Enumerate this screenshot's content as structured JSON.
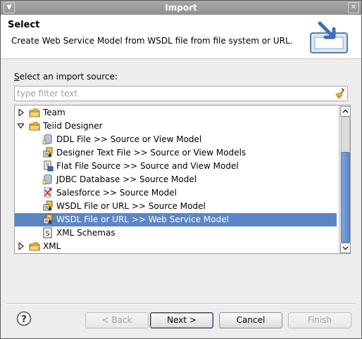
{
  "window": {
    "title": "Import"
  },
  "header": {
    "title": "Select",
    "description": "Create Web Service Model from WSDL file from file system or URL."
  },
  "source_label": {
    "mnemonic": "S",
    "rest": "elect an import source:"
  },
  "filter": {
    "placeholder": "type filter text",
    "value": ""
  },
  "tree": {
    "items": [
      {
        "label": "Team",
        "level": 0,
        "kind": "folder",
        "expander": "collapsed",
        "selected": false
      },
      {
        "label": "Teiid Designer",
        "level": 0,
        "kind": "folder",
        "expander": "expanded",
        "selected": false
      },
      {
        "label": "DDL File >> Source or View Model",
        "level": 1,
        "kind": "db",
        "selected": false
      },
      {
        "label": "Designer Text File >> Source or View Models",
        "level": 1,
        "kind": "package",
        "selected": false
      },
      {
        "label": "Flat File Source >> Source and View Model",
        "level": 1,
        "kind": "flatfile",
        "selected": false
      },
      {
        "label": "JDBC Database >> Source Model",
        "level": 1,
        "kind": "db",
        "selected": false
      },
      {
        "label": "Salesforce >> Source Model",
        "level": 1,
        "kind": "salesforce",
        "selected": false
      },
      {
        "label": "WSDL File or URL >> Source Model",
        "level": 1,
        "kind": "package",
        "selected": false
      },
      {
        "label": "WSDL File or URL >> Web Service Model",
        "level": 1,
        "kind": "package",
        "selected": true
      },
      {
        "label": "XML Schemas",
        "level": 1,
        "kind": "schema",
        "selected": false
      },
      {
        "label": "XML",
        "level": 0,
        "kind": "folder",
        "expander": "collapsed",
        "selected": false
      }
    ]
  },
  "buttons": {
    "back": "< Back",
    "next": "Next >",
    "cancel": "Cancel",
    "finish": "Finish"
  },
  "colors": {
    "selection": "#5b86c6",
    "titlebar": "#999999",
    "dialog_bg": "#ededed"
  }
}
